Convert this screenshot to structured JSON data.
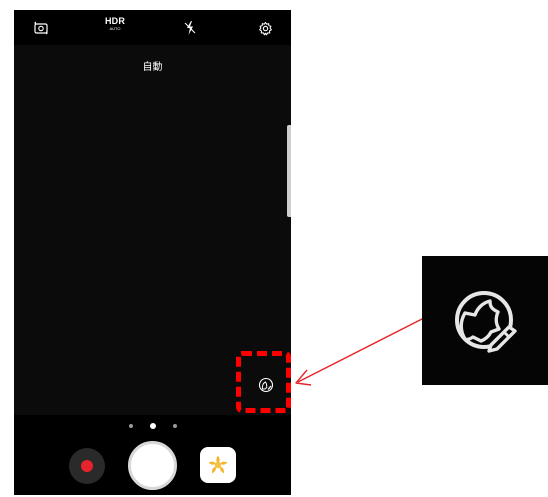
{
  "topbar": {
    "icons": [
      "camera-switch-icon",
      "hdr-auto-icon",
      "flash-off-icon",
      "settings-gear-icon"
    ],
    "hdr_label": "HDR",
    "hdr_sublabel": "AUTO"
  },
  "viewfinder": {
    "mode_label": "自動",
    "sticker_button_icon": "sticker-face-icon"
  },
  "bottombar": {
    "page_dots": 3,
    "active_dot": 2,
    "record_icon": "record-icon",
    "shutter": "shutter-button",
    "gallery_icon": "gallery-flower-icon"
  },
  "annotation": {
    "highlight_color": "#ff0000",
    "arrow_color": "#e8232b",
    "zoom_icon": "sticker-face-icon"
  }
}
